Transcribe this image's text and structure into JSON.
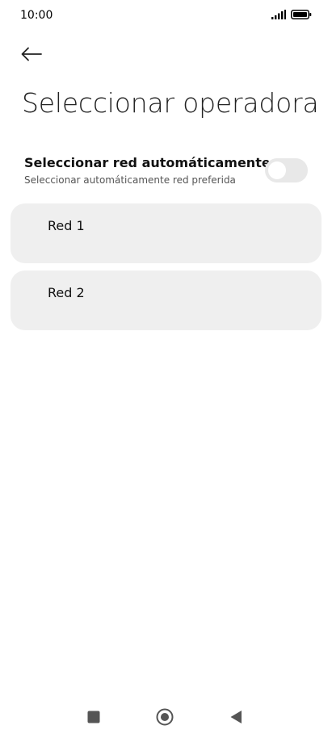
{
  "status_bar": {
    "time": "10:00",
    "signal_icon": "signal-icon",
    "battery_icon": "battery-icon"
  },
  "header": {
    "back_icon": "arrow-left-icon",
    "title": "Seleccionar operadora"
  },
  "auto_select": {
    "title": "Seleccionar red automáticamente",
    "subtitle": "Seleccionar automáticamente red preferida",
    "toggle_state": "off"
  },
  "networks": [
    {
      "label": "Red 1"
    },
    {
      "label": "Red 2"
    }
  ],
  "nav_bar": {
    "recents_icon": "square-icon",
    "home_icon": "circle-icon",
    "back_icon": "triangle-back-icon"
  }
}
